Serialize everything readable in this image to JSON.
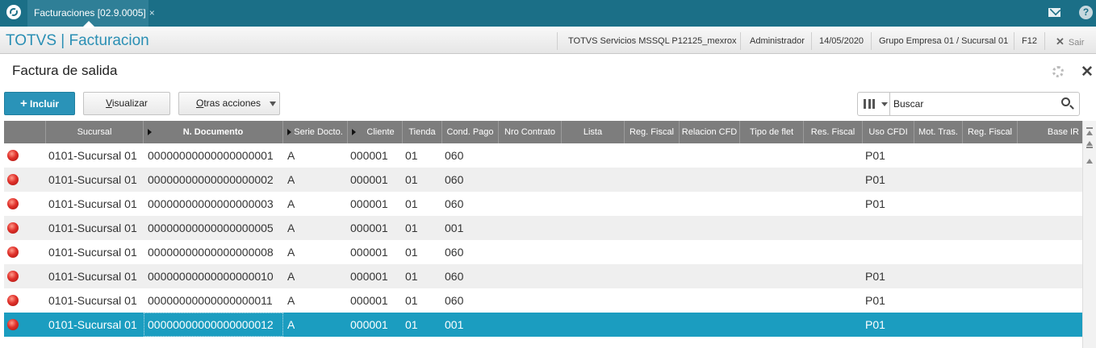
{
  "app": {
    "tab_label": "Facturaciones [02.9.0005]",
    "tab_close": "×",
    "help": "?"
  },
  "header": {
    "brand": "TOTVS | Facturacion",
    "environment": "TOTVS Servicios MSSQL P12125_mexrox",
    "user": "Administrador",
    "date": "14/05/2020",
    "company": "Grupo Empresa 01 / Sucursal 01",
    "shortcut": "F12",
    "exit_label": "Sair"
  },
  "page": {
    "title": "Factura de salida"
  },
  "toolbar": {
    "incluir": "Incluir",
    "visualizar_first": "V",
    "visualizar_rest": "isualizar",
    "otras_first": "O",
    "otras_rest": "tras acciones"
  },
  "search": {
    "placeholder": "Buscar"
  },
  "grid": {
    "columns": [
      "Sucursal",
      "N. Documento",
      "Serie Docto.",
      "Cliente",
      "Tienda",
      "Cond. Pago",
      "Nro Contrato",
      "Lista",
      "Reg. Fiscal",
      "Relacion CFD",
      "Tipo de flet",
      "Res. Fiscal",
      "Uso CFDI",
      "Mot. Tras.",
      "Reg. Fiscal",
      "Base IR"
    ],
    "rows": [
      {
        "status": "red",
        "sucursal": "0101-Sucursal 01",
        "documento": "00000000000000000001",
        "serie": "A",
        "cliente": "000001",
        "tienda": "01",
        "cond_pago": "060",
        "uso_cfdi": "P01"
      },
      {
        "status": "red",
        "sucursal": "0101-Sucursal 01",
        "documento": "00000000000000000002",
        "serie": "A",
        "cliente": "000001",
        "tienda": "01",
        "cond_pago": "060",
        "uso_cfdi": "P01"
      },
      {
        "status": "red",
        "sucursal": "0101-Sucursal 01",
        "documento": "00000000000000000003",
        "serie": "A",
        "cliente": "000001",
        "tienda": "01",
        "cond_pago": "060",
        "uso_cfdi": "P01"
      },
      {
        "status": "red",
        "sucursal": "0101-Sucursal 01",
        "documento": "00000000000000000005",
        "serie": "A",
        "cliente": "000001",
        "tienda": "01",
        "cond_pago": "001",
        "uso_cfdi": ""
      },
      {
        "status": "red",
        "sucursal": "0101-Sucursal 01",
        "documento": "00000000000000000008",
        "serie": "A",
        "cliente": "000001",
        "tienda": "01",
        "cond_pago": "060",
        "uso_cfdi": ""
      },
      {
        "status": "red",
        "sucursal": "0101-Sucursal 01",
        "documento": "00000000000000000010",
        "serie": "A",
        "cliente": "000001",
        "tienda": "01",
        "cond_pago": "060",
        "uso_cfdi": "P01"
      },
      {
        "status": "red",
        "sucursal": "0101-Sucursal 01",
        "documento": "00000000000000000011",
        "serie": "A",
        "cliente": "000001",
        "tienda": "01",
        "cond_pago": "060",
        "uso_cfdi": "P01"
      },
      {
        "status": "red",
        "sucursal": "0101-Sucursal 01",
        "documento": "00000000000000000012",
        "serie": "A",
        "cliente": "000001",
        "tienda": "01",
        "cond_pago": "001",
        "uso_cfdi": "P01",
        "selected": true
      }
    ]
  },
  "colors": {
    "topbar": "#1b6f87",
    "brand": "#2a8fb4",
    "primary_button": "#2a93b8",
    "selected_row": "#1b9dc0",
    "header_row": "#7d7d7d",
    "status_red": "#e0302a"
  }
}
